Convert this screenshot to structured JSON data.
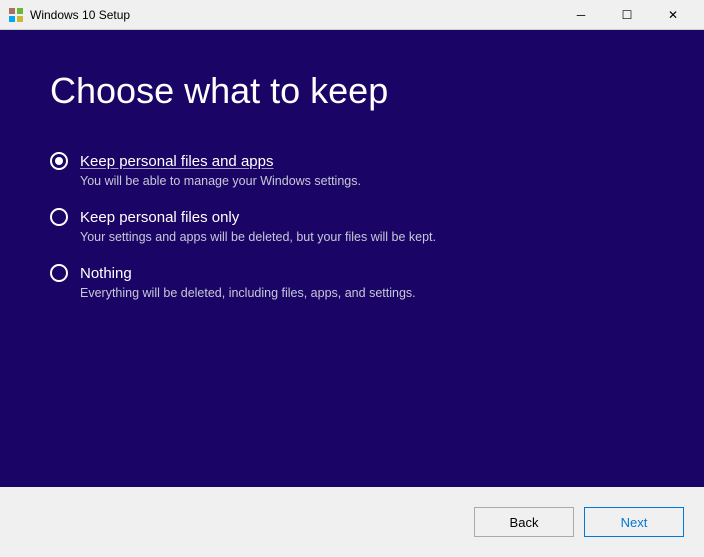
{
  "titleBar": {
    "icon": "windows-setup-icon",
    "title": "Windows 10 Setup",
    "minimizeLabel": "─",
    "restoreLabel": "☐",
    "closeLabel": "✕"
  },
  "page": {
    "title": "Choose what to keep"
  },
  "options": [
    {
      "id": "keep-files-apps",
      "label": "Keep personal files and apps",
      "description": "You will be able to manage your Windows settings.",
      "selected": true
    },
    {
      "id": "keep-files-only",
      "label": "Keep personal files only",
      "description": "Your settings and apps will be deleted, but your files will be kept.",
      "selected": false
    },
    {
      "id": "nothing",
      "label": "Nothing",
      "description": "Everything will be deleted, including files, apps, and settings.",
      "selected": false
    }
  ],
  "buttons": {
    "back": "Back",
    "next": "Next"
  }
}
